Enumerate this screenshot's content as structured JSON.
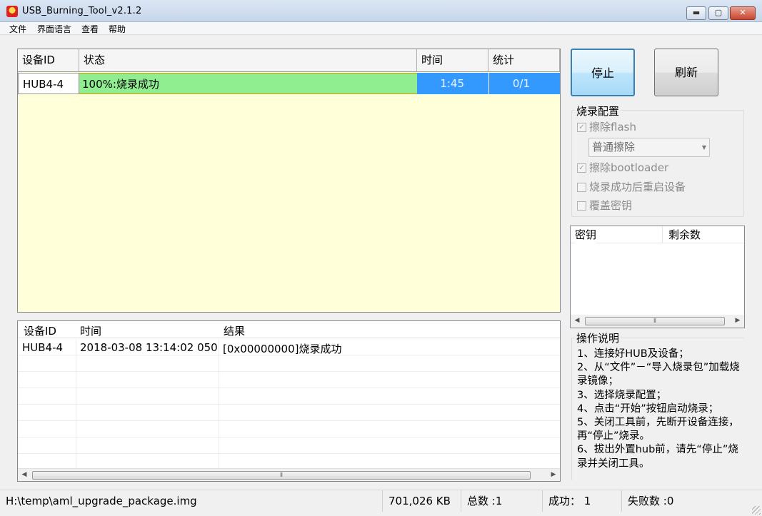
{
  "window": {
    "title": "USB_Burning_Tool_v2.1.2",
    "controls": {
      "minimize": "▬",
      "maximize": "▢",
      "close": "✕"
    }
  },
  "menu": [
    "文件",
    "界面语言",
    "查看",
    "帮助"
  ],
  "device_table": {
    "headers": [
      "设备ID",
      "状态",
      "时间",
      "统计"
    ],
    "rows": [
      {
        "id": "HUB4-4",
        "status": "100%:烧录成功",
        "time": "1:45",
        "count": "0/1"
      }
    ]
  },
  "log_table": {
    "headers": [
      "设备ID",
      "时间",
      "结果"
    ],
    "rows": [
      {
        "id": "HUB4-4",
        "time": "2018-03-08 13:14:02 050",
        "result": "[0x00000000]烧录成功"
      }
    ]
  },
  "buttons": {
    "stop": "停止",
    "refresh": "刷新"
  },
  "burn_config": {
    "title": "烧录配置",
    "erase_flash": {
      "label": "擦除flash",
      "checked": true
    },
    "erase_mode": "普通擦除",
    "erase_bootloader": {
      "label": "擦除bootloader",
      "checked": true
    },
    "reboot_after": {
      "label": "烧录成功后重启设备",
      "checked": false
    },
    "overwrite_key": {
      "label": "覆盖密钥",
      "checked": false
    }
  },
  "key_table": {
    "headers": [
      "密钥",
      "剩余数"
    ]
  },
  "instructions": {
    "title": "操作说明",
    "text": "1、连接好HUB及设备；\n2、从“文件”－“导入烧录包”加载烧录镜像；\n3、选择烧录配置；\n4、点击“开始”按钮启动烧录；\n5、关闭工具前，先断开设备连接，再“停止”烧录。\n6、拔出外置hub前，请先“停止”烧录并关闭工具。"
  },
  "status_bar": {
    "path": "H:\\temp\\aml_upgrade_package.img",
    "size": "701,026 KB",
    "total": "总数 :1",
    "success": "成功：  1",
    "failed": "失败数 :0"
  },
  "colors": {
    "device_panel_bg": "#ffffd9",
    "status_success": "#90ee90",
    "selection": "#3399ff"
  }
}
